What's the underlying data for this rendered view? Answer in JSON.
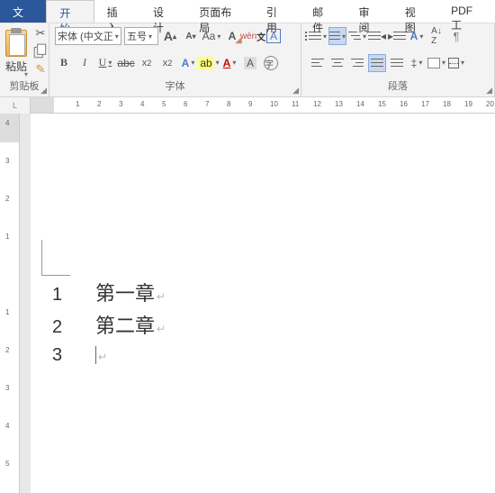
{
  "tabs": {
    "file": "文件",
    "home": "开始",
    "insert": "插入",
    "design": "设计",
    "layout": "页面布局",
    "references": "引用",
    "mailings": "邮件",
    "review": "审阅",
    "view": "视图",
    "pdf": "PDF工"
  },
  "clipboard": {
    "paste": "粘贴",
    "label": "剪贴板"
  },
  "font": {
    "name": "宋体 (中文正",
    "size": "五号",
    "label": "字体"
  },
  "paragraph": {
    "label": "段落"
  },
  "ruler": {
    "corner": "L"
  },
  "doc": {
    "lines": [
      {
        "num": "1",
        "text": "第一章"
      },
      {
        "num": "2",
        "text": "第二章"
      },
      {
        "num": "3",
        "text": ""
      }
    ]
  }
}
